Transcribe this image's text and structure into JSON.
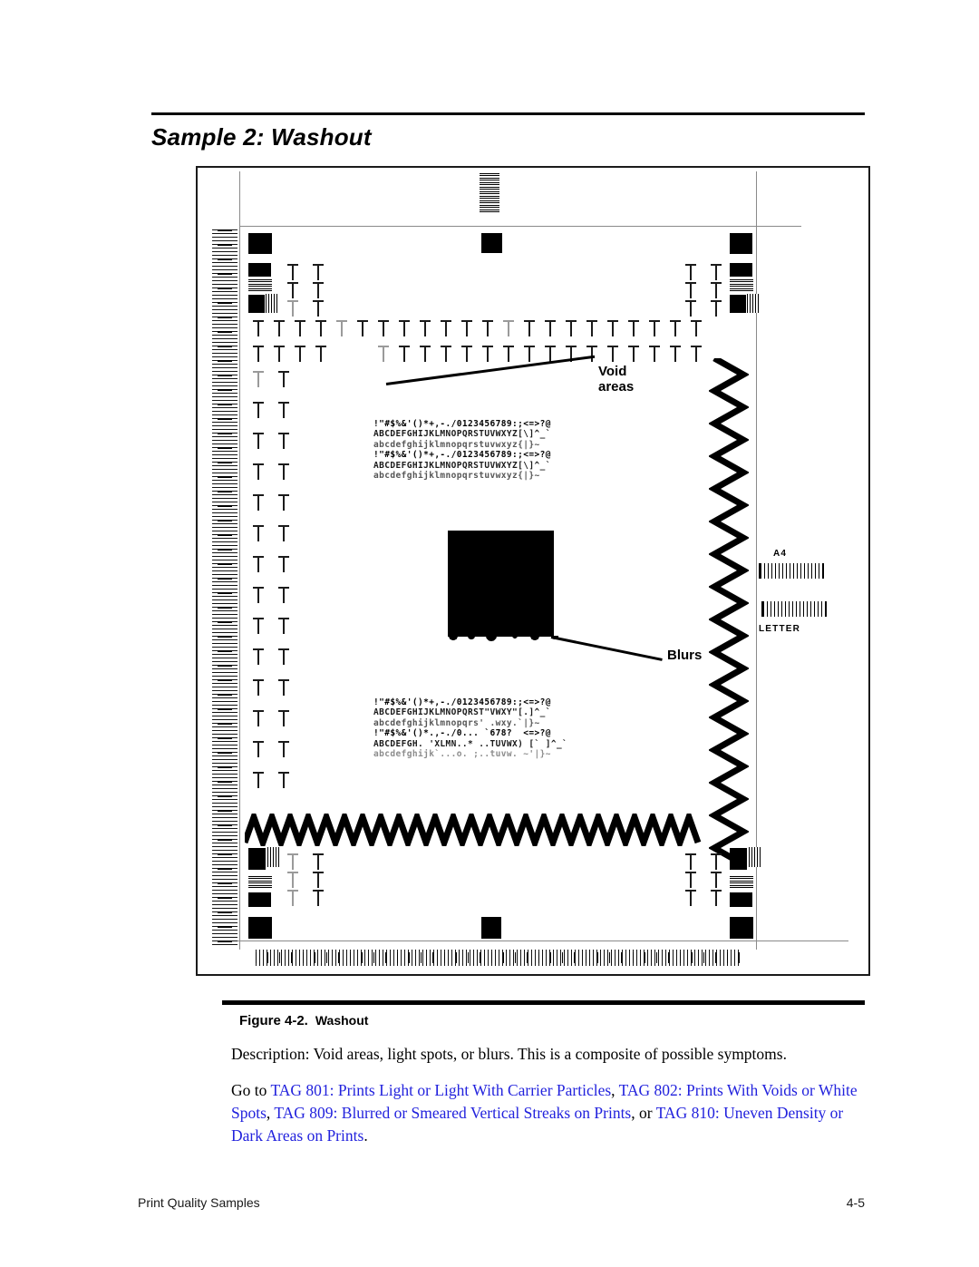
{
  "document": {
    "section_title": "Sample 2: Washout",
    "figure_caption_number": "Figure 4-2.",
    "figure_caption_name": "Washout",
    "description": "Description: Void areas, light spots, or blurs. This is a composite of possible symptoms.",
    "goto": {
      "lead": "Go to ",
      "links": [
        {
          "text": "TAG 801: Prints Light or Light With Carrier Particles",
          "separator": ", "
        },
        {
          "text": "TAG 802: Prints With Voids or White Spots",
          "separator": ", "
        },
        {
          "text": "TAG 809: Blurred or Smeared Vertical Streaks on Prints",
          "separator": ", or "
        },
        {
          "text": "TAG 810: Uneven Density or Dark Areas on Prints",
          "separator": "."
        }
      ],
      "link_color": "#2222dd"
    },
    "footer": {
      "left": "Print Quality Samples",
      "right": "4-5"
    }
  },
  "figure": {
    "callouts": [
      {
        "label": "Void\nareas",
        "name": "void-areas"
      },
      {
        "label": "Blurs",
        "name": "blurs"
      }
    ],
    "paper_sizes": [
      {
        "label": "A4"
      },
      {
        "label": "LETTER"
      }
    ],
    "ascii_samples": [
      {
        "lines": [
          "!\"#$%&'()*+,-./0123456789:;<=>?@",
          "ABCDEFGHIJKLMNOPQRSTUVWXYZ[\\]^_`",
          "abcdefghijklmnopqrstuvwxyz{|}~",
          "!\"#$%&'()*+,-./0123456789:;<=>?@",
          "ABCDEFGHIJKLMNOPQRSTUVWXYZ[\\]^_`",
          "abcdefghijklmnopqrstuvwxyz{|}~"
        ]
      },
      {
        "lines": [
          "!\"#$%&'()*+,-./0123456789:;<=>?@",
          "ABCDEFGHIJKLMNOPQRST\"VWXY\"[.]^_`",
          "abcdefghijklmnopqrs' .wxy.`|}~",
          "!\"#$%&'()*.,-./0... `678?  <=>?@",
          "ABCDEFGH. 'XLMN..* ..TUVWX) [` ]^_`",
          "abcdefghijk`...o. ;..tuvw. ~'|}~"
        ]
      }
    ]
  }
}
